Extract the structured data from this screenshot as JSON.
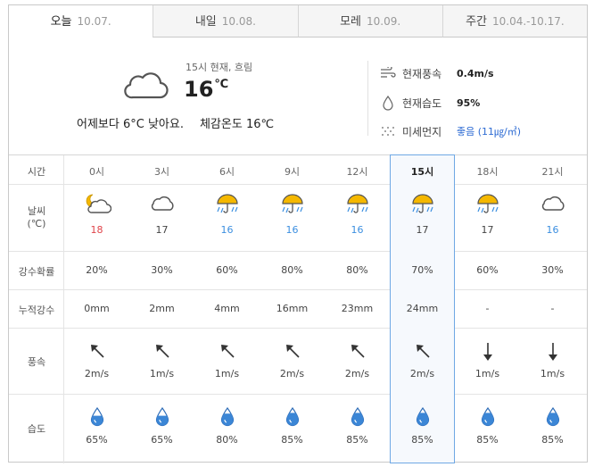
{
  "tabs": [
    {
      "name": "오늘",
      "date": "10.07.",
      "active": true
    },
    {
      "name": "내일",
      "date": "10.08.",
      "active": false
    },
    {
      "name": "모레",
      "date": "10.09.",
      "active": false
    },
    {
      "name": "주간",
      "date": "10.04.-10.17.",
      "active": false
    }
  ],
  "current": {
    "label": "15시 현재, 흐림",
    "temp": "16",
    "unit": "℃",
    "compare": "어제보다 6°C 낮아요.",
    "feels": "체감온도 16℃",
    "icon": "cloud-icon"
  },
  "info": {
    "wind": {
      "label": "현재풍속",
      "value": "0.4m/s",
      "icon": "wind-icon"
    },
    "humidity": {
      "label": "현재습도",
      "value": "95%",
      "icon": "humidity-drop-icon"
    },
    "dust": {
      "label": "미세먼지",
      "value": "좋음 (11㎍/㎥)",
      "icon": "dust-icon"
    }
  },
  "row_labels": {
    "time": "시간",
    "weather_line1": "날씨",
    "weather_line2": "(℃)",
    "precip_prob": "강수확률",
    "accum_precip": "누적강수",
    "wind": "풍속",
    "humidity": "습도"
  },
  "colors": {
    "highlight_border": "#6fa8e4",
    "high_temp": "#e0444a",
    "low_temp": "#3c8fe0",
    "good": "#2d6bd3"
  },
  "hours": [
    {
      "time": "0시",
      "icon": "partly-cloudy-night-icon",
      "temp": "18",
      "temp_color": "red",
      "prob": "20%",
      "accum": "0mm",
      "wind_dir": "northwest",
      "wind": "2m/s",
      "humidity": "65%",
      "humidity_level": 0.65
    },
    {
      "time": "3시",
      "icon": "cloud-icon",
      "temp": "17",
      "temp_color": "normal",
      "prob": "30%",
      "accum": "2mm",
      "wind_dir": "northwest",
      "wind": "1m/s",
      "humidity": "65%",
      "humidity_level": 0.65
    },
    {
      "time": "6시",
      "icon": "rain-umbrella-icon",
      "temp": "16",
      "temp_color": "blue",
      "prob": "60%",
      "accum": "4mm",
      "wind_dir": "northwest",
      "wind": "1m/s",
      "humidity": "80%",
      "humidity_level": 0.8
    },
    {
      "time": "9시",
      "icon": "rain-umbrella-icon",
      "temp": "16",
      "temp_color": "blue",
      "prob": "80%",
      "accum": "16mm",
      "wind_dir": "northwest",
      "wind": "2m/s",
      "humidity": "85%",
      "humidity_level": 0.85
    },
    {
      "time": "12시",
      "icon": "rain-umbrella-icon",
      "temp": "16",
      "temp_color": "blue",
      "prob": "80%",
      "accum": "23mm",
      "wind_dir": "northwest",
      "wind": "2m/s",
      "humidity": "85%",
      "humidity_level": 0.85
    },
    {
      "time": "15시",
      "icon": "rain-umbrella-icon",
      "temp": "17",
      "temp_color": "normal",
      "prob": "70%",
      "accum": "24mm",
      "wind_dir": "northwest",
      "wind": "2m/s",
      "humidity": "85%",
      "humidity_level": 0.85,
      "current": true
    },
    {
      "time": "18시",
      "icon": "rain-umbrella-icon",
      "temp": "17",
      "temp_color": "normal",
      "prob": "60%",
      "accum": "-",
      "wind_dir": "south",
      "wind": "1m/s",
      "humidity": "85%",
      "humidity_level": 0.85
    },
    {
      "time": "21시",
      "icon": "cloud-icon",
      "temp": "16",
      "temp_color": "blue",
      "prob": "30%",
      "accum": "-",
      "wind_dir": "south",
      "wind": "1m/s",
      "humidity": "85%",
      "humidity_level": 0.85
    }
  ]
}
